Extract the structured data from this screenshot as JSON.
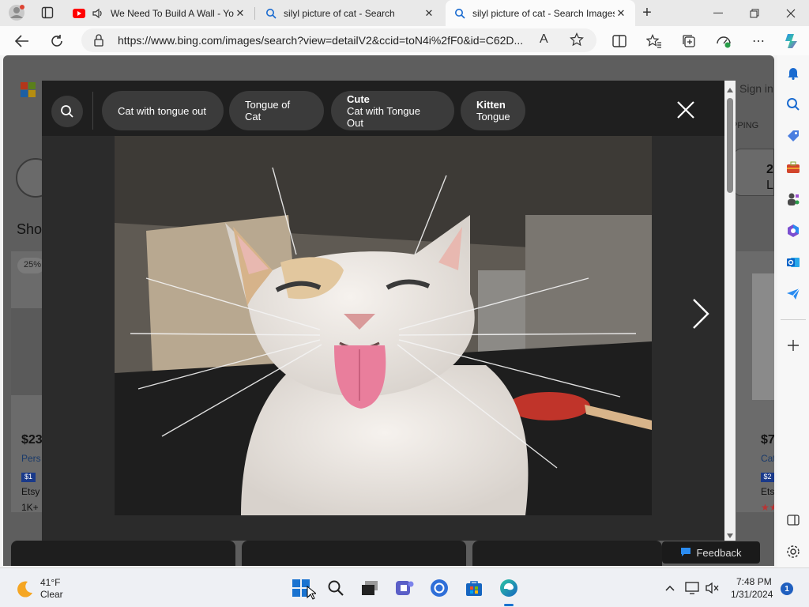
{
  "browser": {
    "tabs": [
      {
        "title": "We Need To Build A Wall - YouTube",
        "icon": "youtube-icon",
        "audio": true
      },
      {
        "title": "silyl picture of cat - Search",
        "icon": "search-icon"
      },
      {
        "title": "silyl picture of cat - Search Images",
        "icon": "search-icon",
        "active": true
      }
    ],
    "new_tab_label": "+",
    "address": "https://www.bing.com/images/search?view=detailV2&ccid=toN4i%2fF0&id=C62D...",
    "read_aloud_label": "A",
    "sidebar_icons": [
      "bell-icon",
      "search-icon",
      "tag-icon",
      "toolbox-icon",
      "games-icon",
      "microsoft365-icon",
      "outlook-icon",
      "send-icon",
      "add-icon",
      "split-icon",
      "settings-icon"
    ]
  },
  "page": {
    "bg_fragments": {
      "sign_in": "Sign in",
      "shopping": "PPING",
      "shop": "Sho",
      "discount": "25%",
      "price_left": "$23",
      "pers": "Pers",
      "s1": "$1",
      "etsy_left": "Etsy",
      "count": "1K+",
      "price_right": "$7",
      "cat": "Cat",
      "s2": "$2",
      "etsy_right": "Ets",
      "two": "2",
      "L": "L"
    },
    "overlay": {
      "chips": [
        {
          "line1": "Cat with tongue out",
          "line2": ""
        },
        {
          "line1": "Tongue of Cat",
          "line2": ""
        },
        {
          "line1": "Cute",
          "line2": "Cat with Tongue Out"
        },
        {
          "line1": "Kitten",
          "line2": "Tongue"
        }
      ],
      "image_alt": "White cat sticking its tongue out"
    },
    "feedback_label": "Feedback"
  },
  "taskbar": {
    "weather": {
      "temp": "41°F",
      "condition": "Clear"
    },
    "apps": [
      "windows-start-icon",
      "search-icon",
      "task-view-icon",
      "teams-icon",
      "chrome-icon",
      "store-icon",
      "edge-icon"
    ],
    "clock": {
      "time": "7:48 PM",
      "date": "1/31/2024"
    },
    "notification_count": "1"
  },
  "colors": {
    "accent": "#0078d4",
    "overlay_bg": "#2b2b2b",
    "chip_bg": "#3b3b3b",
    "youtube_red": "#ff0000"
  }
}
